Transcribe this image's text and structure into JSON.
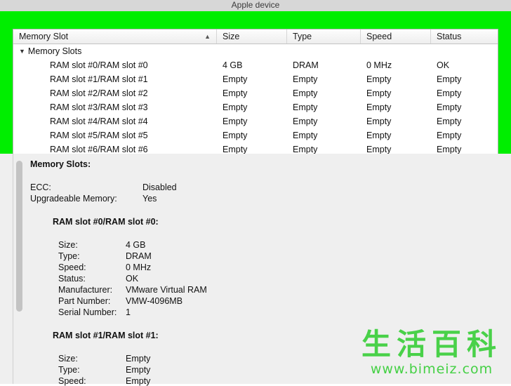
{
  "window": {
    "title": "Apple device"
  },
  "highlight_color": "#00ee00",
  "table": {
    "columns": [
      {
        "label": "Memory Slot",
        "sort_icon": "chevron-up-icon"
      },
      {
        "label": "Size"
      },
      {
        "label": "Type"
      },
      {
        "label": "Speed"
      },
      {
        "label": "Status"
      }
    ],
    "group": {
      "disclosure_icon": "triangle-down-icon",
      "label": "Memory Slots"
    },
    "rows": [
      {
        "name": "RAM slot #0/RAM slot #0",
        "size": "4 GB",
        "type": "DRAM",
        "speed": "0 MHz",
        "status": "OK"
      },
      {
        "name": "RAM slot #1/RAM slot #1",
        "size": "Empty",
        "type": "Empty",
        "speed": "Empty",
        "status": "Empty"
      },
      {
        "name": "RAM slot #2/RAM slot #2",
        "size": "Empty",
        "type": "Empty",
        "speed": "Empty",
        "status": "Empty"
      },
      {
        "name": "RAM slot #3/RAM slot #3",
        "size": "Empty",
        "type": "Empty",
        "speed": "Empty",
        "status": "Empty"
      },
      {
        "name": "RAM slot #4/RAM slot #4",
        "size": "Empty",
        "type": "Empty",
        "speed": "Empty",
        "status": "Empty"
      },
      {
        "name": "RAM slot #5/RAM slot #5",
        "size": "Empty",
        "type": "Empty",
        "speed": "Empty",
        "status": "Empty"
      },
      {
        "name": "RAM slot #6/RAM slot #6",
        "size": "Empty",
        "type": "Empty",
        "speed": "Empty",
        "status": "Empty"
      }
    ]
  },
  "detail": {
    "title": "Memory Slots:",
    "ecc_label": "ECC:",
    "ecc_value": "Disabled",
    "upgradeable_label": "Upgradeable Memory:",
    "upgradeable_value": "Yes",
    "slot0": {
      "heading": "RAM slot #0/RAM slot #0:",
      "fields": [
        {
          "key": "Size:",
          "value": "4 GB"
        },
        {
          "key": "Type:",
          "value": "DRAM"
        },
        {
          "key": "Speed:",
          "value": "0 MHz"
        },
        {
          "key": "Status:",
          "value": "OK"
        },
        {
          "key": "Manufacturer:",
          "value": "VMware Virtual RAM"
        },
        {
          "key": "Part Number:",
          "value": "VMW-4096MB"
        },
        {
          "key": "Serial Number:",
          "value": "1"
        }
      ]
    },
    "slot1": {
      "heading": "RAM slot #1/RAM slot #1:",
      "fields": [
        {
          "key": "Size:",
          "value": "Empty"
        },
        {
          "key": "Type:",
          "value": "Empty"
        },
        {
          "key": "Speed:",
          "value": "Empty"
        }
      ]
    }
  },
  "watermark": {
    "chars": "生活百科",
    "url": "www.bimeiz.com",
    "color": "#3ccf3c"
  }
}
